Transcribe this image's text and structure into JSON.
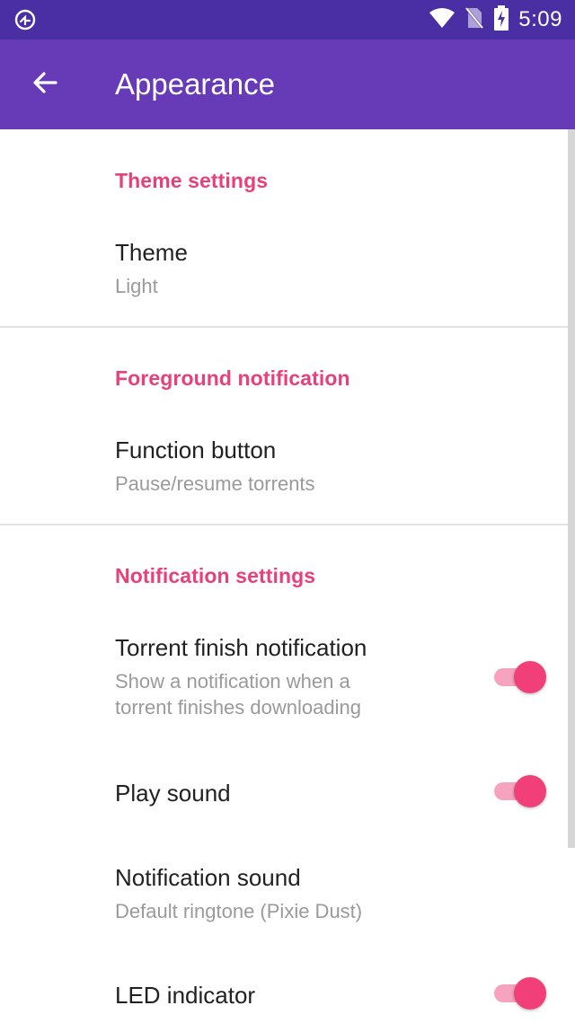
{
  "status_bar": {
    "time": "5:09",
    "icons": [
      "app-notification-icon",
      "wifi-icon",
      "no-sim-icon",
      "battery-charging-icon"
    ]
  },
  "app_bar": {
    "title": "Appearance",
    "back_icon": "arrow-back-icon",
    "background": "#673ab7"
  },
  "colors": {
    "status_bar": "#4a2ea3",
    "accent": "#e9407a",
    "switch_thumb": "#f13f7a",
    "switch_track": "#f5a3bf"
  },
  "sections": [
    {
      "header": "Theme settings",
      "items": [
        {
          "title": "Theme",
          "summary": "Light"
        }
      ]
    },
    {
      "header": "Foreground notification",
      "items": [
        {
          "title": "Function button",
          "summary": "Pause/resume torrents"
        }
      ]
    },
    {
      "header": "Notification settings",
      "items": [
        {
          "title": "Torrent finish notification",
          "summary_line1": "Show a notification when a",
          "summary_line2": "torrent finishes downloading",
          "switch_on": true
        },
        {
          "title": "Play sound",
          "switch_on": true
        },
        {
          "title": "Notification sound",
          "summary": "Default ringtone (Pixie Dust)"
        },
        {
          "title": "LED indicator",
          "switch_on": true
        }
      ]
    }
  ]
}
